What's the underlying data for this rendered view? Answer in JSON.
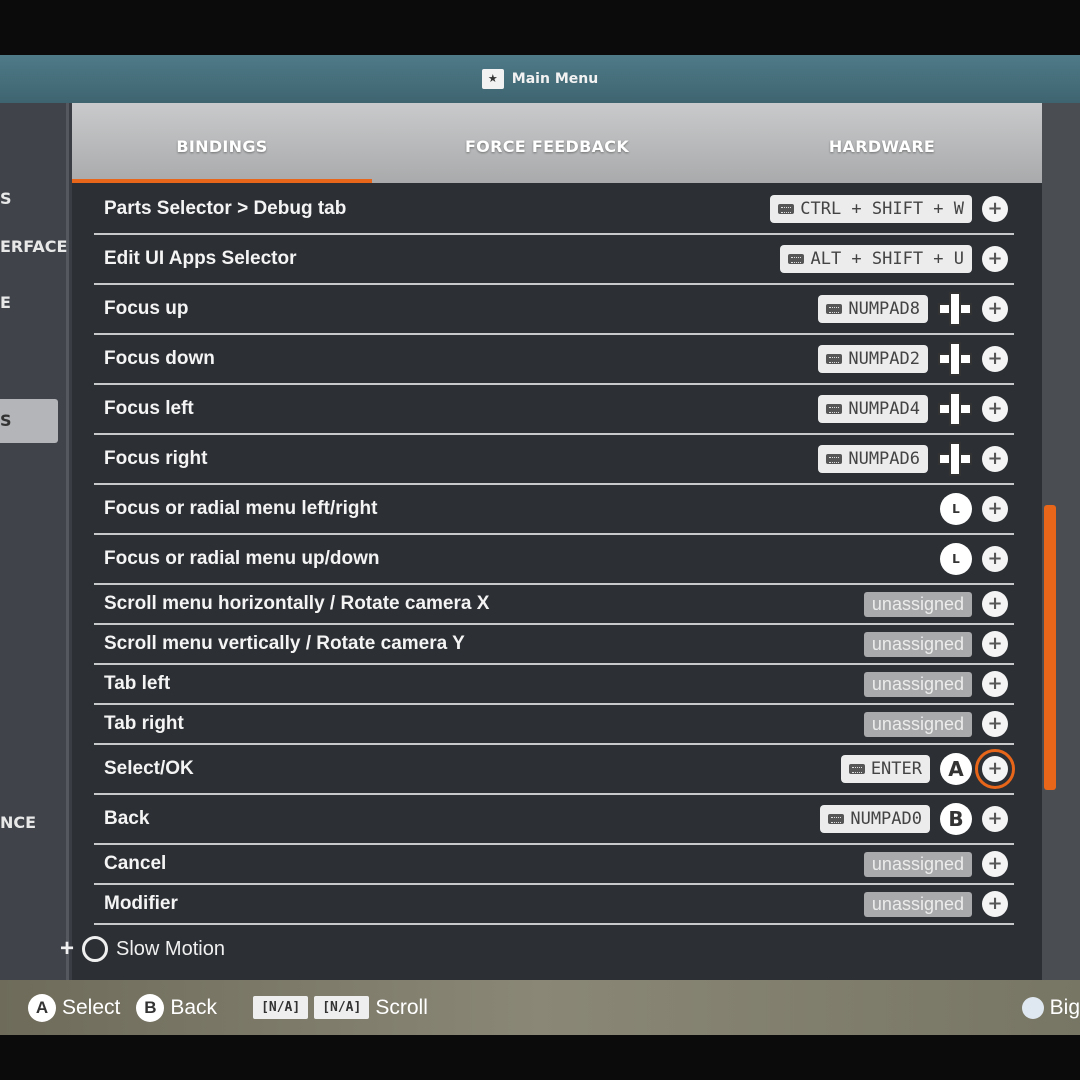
{
  "window": {
    "title": "Main Menu"
  },
  "sidebar": {
    "items": [
      {
        "label": "S"
      },
      {
        "label": "ERFACE"
      },
      {
        "label": "E"
      },
      {
        "label": "S",
        "selected": true
      },
      {
        "label": "NCE"
      }
    ]
  },
  "tabs": [
    {
      "label": "BINDINGS",
      "active": true
    },
    {
      "label": "FORCE FEEDBACK"
    },
    {
      "label": "HARDWARE"
    }
  ],
  "bindings": [
    {
      "label": "Parts Selector > Debug tab",
      "keyboard": "CTRL + SHIFT + W",
      "gamepad": null,
      "assigned": true
    },
    {
      "label": "Edit UI Apps Selector",
      "keyboard": "ALT + SHIFT + U",
      "gamepad": null,
      "assigned": true
    },
    {
      "label": "Focus up",
      "keyboard": "NUMPAD8",
      "gamepad": "dpad-icon",
      "assigned": true
    },
    {
      "label": "Focus down",
      "keyboard": "NUMPAD2",
      "gamepad": "dpad-icon",
      "assigned": true
    },
    {
      "label": "Focus left",
      "keyboard": "NUMPAD4",
      "gamepad": "dpad-icon",
      "assigned": true
    },
    {
      "label": "Focus right",
      "keyboard": "NUMPAD6",
      "gamepad": "dpad-icon",
      "assigned": true
    },
    {
      "label": "Focus or radial menu left/right",
      "keyboard": null,
      "gamepad": "left-stick-horizontal-icon",
      "stick_text": "L",
      "assigned": true
    },
    {
      "label": "Focus or radial menu up/down",
      "keyboard": null,
      "gamepad": "left-stick-vertical-icon",
      "stick_text": "L",
      "assigned": true
    },
    {
      "label": "Scroll menu horizontally / Rotate camera X",
      "unassigned_text": "unassigned",
      "assigned": false
    },
    {
      "label": "Scroll menu vertically / Rotate camera Y",
      "unassigned_text": "unassigned",
      "assigned": false
    },
    {
      "label": "Tab left",
      "unassigned_text": "unassigned",
      "assigned": false
    },
    {
      "label": "Tab right",
      "unassigned_text": "unassigned",
      "assigned": false
    },
    {
      "label": "Select/OK",
      "keyboard": "ENTER",
      "gamepad": "a-button-icon",
      "button_text": "A",
      "assigned": true,
      "focused": true
    },
    {
      "label": "Back",
      "keyboard": "NUMPAD0",
      "gamepad": "b-button-icon",
      "button_text": "B",
      "assigned": true
    },
    {
      "label": "Cancel",
      "unassigned_text": "unassigned",
      "assigned": false
    },
    {
      "label": "Modifier",
      "unassigned_text": "unassigned",
      "assigned": false
    }
  ],
  "add_label": "+",
  "slow_motion": {
    "plus": "+",
    "label": "Slow Motion"
  },
  "footer": {
    "select_button": "A",
    "select_label": "Select",
    "back_button": "B",
    "back_label": "Back",
    "scroll_key1": "[N/A]",
    "scroll_key2": "[N/A]",
    "scroll_label": "Scroll",
    "big_picture_label": "Big"
  },
  "colors": {
    "accent": "#e8661a",
    "panel": "#2c2f34",
    "topbar": "#4f7a88"
  }
}
